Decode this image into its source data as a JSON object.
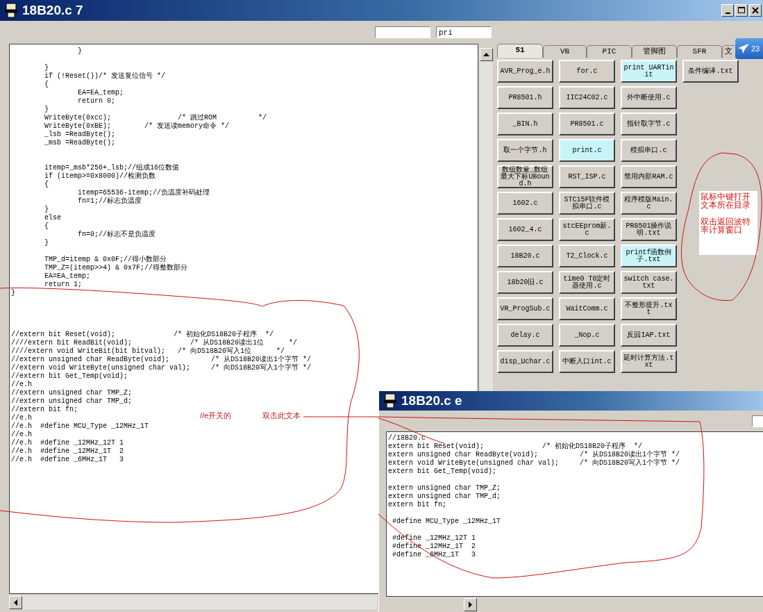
{
  "main_window": {
    "title": "18B20.c 7",
    "find_field": {
      "value": "pri"
    },
    "code": "                }\n\n        }\n        if (!Reset())/* 发送复位信号 */\n        {\n                EA=EA_temp;\n                return 0;\n        }\n        WriteByte(0xcc);                /* 跳过ROM          */\n        WriteByte(0xBE);        /* 发送读memory命令 */\n        _lsb =ReadByte();\n        _msb =ReadByte();\n\n\n        itemp=_msb*256+_lsb;//组成16位数值\n        if (itemp>=0x8000)//检测负数\n        {\n                itemp=65536-itemp;//负温度补码处理\n                fn=1;//标志负温度\n        }\n        else\n        {\n                fn=0;//标志不是负温度\n        }\n\n        TMP_d=itemp & 0x0F;//得小数部分\n        TMP_Z=(itemp>>4) & 0x7F;//得整数部分\n        EA=EA_temp;\n        return 1;\n}\n\n\n\n\n//extern bit Reset(void);              /* 初始化DS18B20子程序  */\n////extern bit ReadBit(void);              /* 从DS18B20读出1位      */\n////extern void WriteBit(bit bitval);   /* 向DS18B20写入1位      */\n//extern unsigned char ReadByte(void);          /* 从DS18B20读出1个字节 */\n//extern void WriteByte(unsigned char val);     /* 向DS18B20写入1个字节 */\n//extern bit Get_Temp(void);\n//e.h\n//extern unsigned char TMP_Z;\n//extern unsigned char TMP_d;\n//extern bit fn;\n//e.h\n//e.h  #define MCU_Type _12MHz_1T\n//e.h\n//e.h  #define _12MHz_12T 1\n//e.h  #define _12MHz_1T  2\n//e.h  #define _6MHz_1T   3"
  },
  "annotations": [
    {
      "text": "//e开关的"
    },
    {
      "text": "双击此文本"
    }
  ],
  "tabs": [
    {
      "label": "51",
      "selected": true
    },
    {
      "label": "VB",
      "selected": false
    },
    {
      "label": "PIC",
      "selected": false
    },
    {
      "label": "管脚图",
      "selected": false
    },
    {
      "label": "SFR",
      "selected": false
    },
    {
      "label": "文",
      "selected": false
    }
  ],
  "file_buttons": [
    {
      "label": "AVR_Prog_e.h",
      "highlighted": false
    },
    {
      "label": "for.c",
      "highlighted": false
    },
    {
      "label": "print UARTinit",
      "highlighted": true
    },
    {
      "label": "PR8501.h",
      "highlighted": false
    },
    {
      "label": "IIC24C02.c",
      "highlighted": false
    },
    {
      "label": "外中断使用.c",
      "highlighted": false
    },
    {
      "label": "_BIN.h",
      "highlighted": false
    },
    {
      "label": "PR8501.c",
      "highlighted": false
    },
    {
      "label": "指针取字节.c",
      "highlighted": false
    },
    {
      "label": "取一个字节.h",
      "highlighted": false
    },
    {
      "label": "print.c",
      "highlighted": true
    },
    {
      "label": "模拟串口.c",
      "highlighted": false
    },
    {
      "label": "数组数量_数组最大下标UBound.h",
      "highlighted": false
    },
    {
      "label": "RST_ISP.c",
      "highlighted": false
    },
    {
      "label": "禁用内部RAM.c",
      "highlighted": false
    },
    {
      "label": "1602.c",
      "highlighted": false
    },
    {
      "label": "STC15F软件模拟串口.c",
      "highlighted": false
    },
    {
      "label": "程序模版Main.c",
      "highlighted": false
    },
    {
      "label": "1602_4.c",
      "highlighted": false
    },
    {
      "label": "stcEEprom新.c",
      "highlighted": false
    },
    {
      "label": "PR8501操作说明.txt",
      "highlighted": false
    },
    {
      "label": "18B20.c",
      "highlighted": false
    },
    {
      "label": "T2_Clock.c",
      "highlighted": false
    },
    {
      "label": "printf函数例子.txt",
      "highlighted": true
    },
    {
      "label": "18b20旧.c",
      "highlighted": false
    },
    {
      "label": "time0 T0定时器使用.c",
      "highlighted": false
    },
    {
      "label": "switch case.txt",
      "highlighted": false
    },
    {
      "label": "VR_ProgSub.c",
      "highlighted": false
    },
    {
      "label": "WaitComm.c",
      "highlighted": false
    },
    {
      "label": "不整形提升.txt",
      "highlighted": false
    },
    {
      "label": "delay.c",
      "highlighted": false
    },
    {
      "label": "_Nop.c",
      "highlighted": false
    },
    {
      "label": "反回IAP.txt",
      "highlighted": false
    },
    {
      "label": "disp_Uchar.c",
      "highlighted": false
    },
    {
      "label": "中断入口int.c",
      "highlighted": false
    },
    {
      "label": "延时计算方法.txt",
      "highlighted": false
    }
  ],
  "side_buttons": [
    {
      "label": "条件编译.txt",
      "highlighted": false
    }
  ],
  "note_panel": {
    "lines": [
      "鼠标中键打开文本所在目录",
      "双击返回波特率计算窗口"
    ]
  },
  "tray_badge": {
    "text": "23"
  },
  "second_window": {
    "title": "18B20.c e",
    "code": "//18B20.c\nextern bit Reset(void);              /* 初始化DS18B20子程序  */\nextern unsigned char ReadByte(void);          /* 从DS18B20读出1个字节 */\nextern void WriteByte(unsigned char val);     /* 向DS18B20写入1个字节 */\nextern bit Get_Temp(void);\n\nextern unsigned char TMP_Z;\nextern unsigned char TMP_d;\nextern bit fn;\n\n #define MCU_Type _12MHz_1T\n\n #define _12MHz_12T 1\n #define _12MHz_1T  2\n #define _6MHz_1T   3"
  }
}
